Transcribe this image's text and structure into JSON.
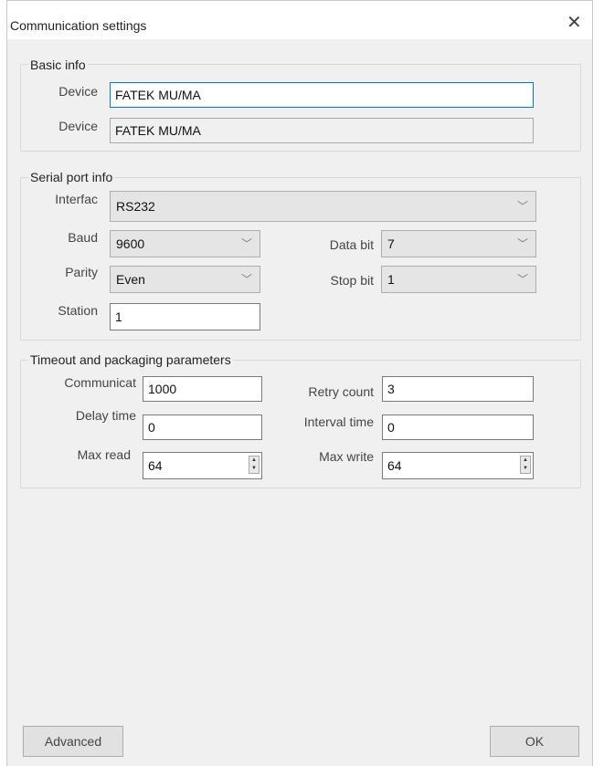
{
  "window": {
    "title": "Communication settings",
    "close_glyph": "✕"
  },
  "basic_info": {
    "legend": "Basic info",
    "device_label_1": "Device",
    "device_value_1": "FATEK MU/MA",
    "device_label_2": "Device",
    "device_value_2": "FATEK MU/MA"
  },
  "serial": {
    "legend": "Serial port info",
    "interface_label": "Interfac",
    "interface_value": "RS232",
    "baud_label": "Baud",
    "baud_value": "9600",
    "data_bit_label": "Data bit",
    "data_bit_value": "7",
    "parity_label": "Parity",
    "parity_value": "Even",
    "stop_bit_label": "Stop bit",
    "stop_bit_value": "1",
    "station_label": "Station",
    "station_value": "1"
  },
  "timeout": {
    "legend": "Timeout and packaging parameters",
    "comm_label": "Communicat",
    "comm_value": "1000",
    "retry_label": "Retry count",
    "retry_value": "3",
    "delay_label": "Delay time",
    "delay_value": "0",
    "interval_label": "Interval time",
    "interval_value": "0",
    "max_read_label": "Max read",
    "max_read_value": "64",
    "max_write_label": "Max write",
    "max_write_value": "64"
  },
  "buttons": {
    "advanced": "Advanced",
    "ok": "OK"
  },
  "icons": {
    "dropdown": "chevron-down-icon",
    "close": "close-icon",
    "spinner": "spinner-arrows-icon"
  }
}
